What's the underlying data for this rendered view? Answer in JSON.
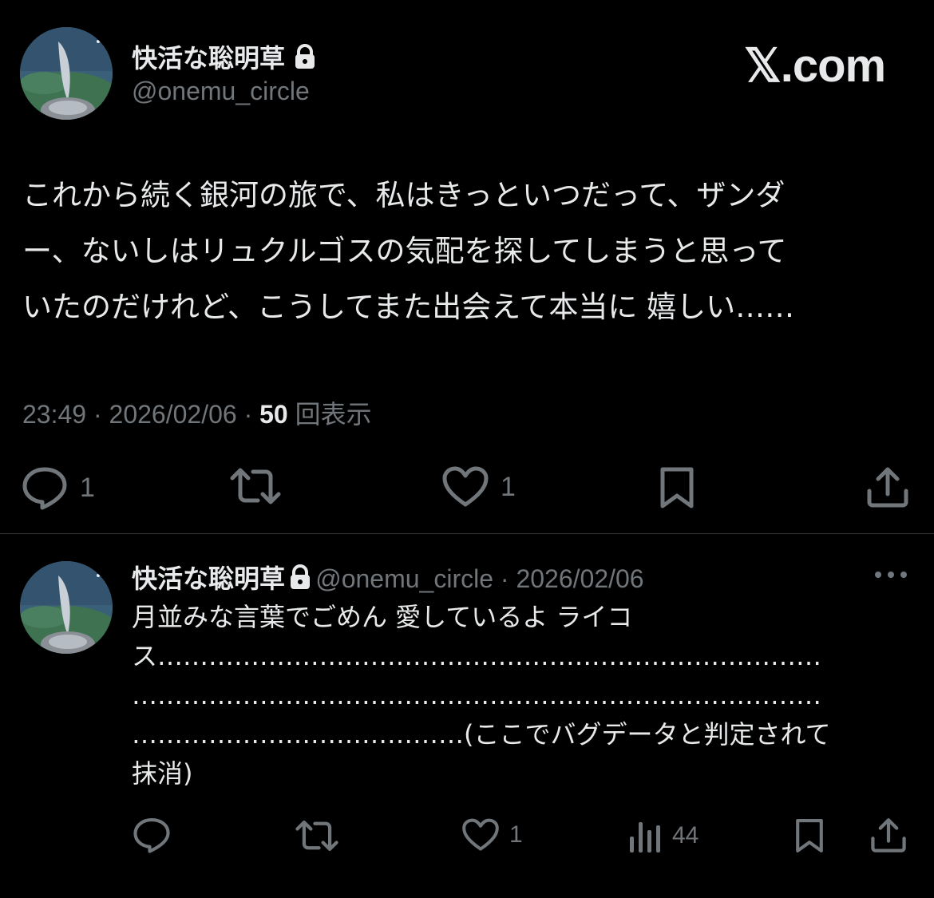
{
  "brand": {
    "name": "𝕏.com"
  },
  "tweet": {
    "author": {
      "display_name": "快活な聡明草",
      "handle": "@onemu_circle",
      "avatar_icon": "avatar-image",
      "protected_icon": "lock-icon"
    },
    "body_lines": [
      "これから続く銀河の旅で、私はきっといつだって、ザンダ",
      "ー、ないしはリュクルゴスの気配を探してしまうと思って",
      "いたのだけれど、こうしてまた出会えて本当に 嬉しい……"
    ],
    "meta": {
      "time": "23:49",
      "sep1": " · ",
      "date": "2026/02/06",
      "sep2": " · ",
      "views_count": "50",
      "views_label": " 回表示"
    },
    "actions": {
      "reply_count": "1",
      "like_count": "1",
      "reply_icon": "reply-icon",
      "retweet_icon": "retweet-icon",
      "like_icon": "heart-icon",
      "bookmark_icon": "bookmark-icon",
      "share_icon": "share-icon"
    }
  },
  "reply": {
    "author": {
      "display_name": "快活な聡明草",
      "handle": "@onemu_circle",
      "sep": " · ",
      "date": "2026/02/06"
    },
    "body_lines": [
      "月並みな言葉でごめん 愛しているよ ライコ",
      "ス……………………………………………………………………",
      "………………………………………………………………………",
      "…………………………………(ここでバグデータと判定されて",
      "抹消)"
    ],
    "actions": {
      "like_count": "1",
      "views_count": "44"
    }
  },
  "colors": {
    "background": "#000000",
    "text": "#e7e9ea",
    "muted": "#71767b",
    "divider": "#2f3336"
  }
}
